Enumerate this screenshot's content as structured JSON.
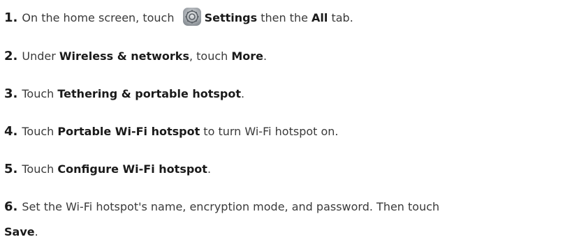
{
  "steps": [
    {
      "num": "1.",
      "t1": "On the home screen, touch ",
      "icon": "settings-gear-icon",
      "b1": "Settings",
      "t2": " then the ",
      "b2": "All",
      "t3": " tab."
    },
    {
      "num": "2.",
      "t1": "Under ",
      "b1": "Wireless & networks",
      "t2": ", touch ",
      "b2": "More",
      "t3": "."
    },
    {
      "num": "3.",
      "t1": "Touch ",
      "b1": "Tethering & portable hotspot",
      "t2": "."
    },
    {
      "num": "4.",
      "t1": "Touch ",
      "b1": "Portable Wi-Fi hotspot",
      "t2": " to turn Wi-Fi hotspot on."
    },
    {
      "num": "5.",
      "t1": "Touch ",
      "b1": "Configure Wi-Fi hotspot",
      "t2": "."
    },
    {
      "num": "6.",
      "t1": "Set the Wi-Fi hotspot's name, encryption mode, and password. Then touch",
      "b1": "Save",
      "t2": "."
    }
  ]
}
